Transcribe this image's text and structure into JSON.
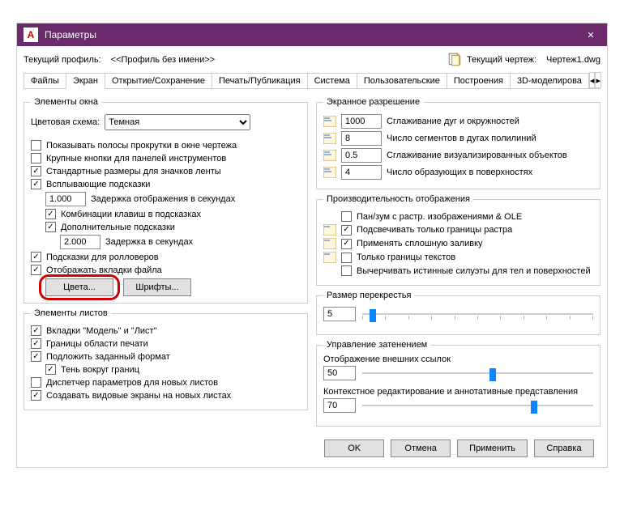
{
  "window": {
    "title": "Параметры",
    "close_icon": "✕"
  },
  "profile": {
    "current_profile_label": "Текущий профиль:",
    "current_profile_value": "<<Профиль без имени>>",
    "current_drawing_label": "Текущий чертеж:",
    "current_drawing_value": "Чертеж1.dwg"
  },
  "tabs": {
    "files": "Файлы",
    "screen": "Экран",
    "open_save": "Открытие/Сохранение",
    "print": "Печать/Публикация",
    "system": "Система",
    "user": "Пользовательские",
    "drafting": "Построения",
    "three_d": "3D-моделирова",
    "arrow_left": "◂",
    "arrow_right": "▸"
  },
  "left": {
    "window_elements": {
      "legend": "Элементы окна",
      "color_scheme_label": "Цветовая схема:",
      "color_scheme_value": "Темная",
      "scrollbars": "Показывать полосы прокрутки в окне чертежа",
      "big_buttons": "Крупные кнопки для панелей инструментов",
      "ribbon_icons": "Стандартные размеры для значков ленты",
      "tooltips": "Всплывающие подсказки",
      "delay1_value": "1.000",
      "delay1_label": "Задержка отображения в секундах",
      "shortcuts": "Комбинации клавиш в подсказках",
      "extra_tooltips": "Дополнительные подсказки",
      "delay2_value": "2.000",
      "delay2_label": "Задержка в секундах",
      "rollover": "Подсказки для ролловеров",
      "file_tabs": "Отображать вкладки файла",
      "colors_btn": "Цвета...",
      "fonts_btn": "Шрифты..."
    },
    "sheet_elements": {
      "legend": "Элементы листов",
      "model_layout": "Вкладки \"Модель\" и \"Лист\"",
      "print_bounds": "Границы области печати",
      "paper_bg": "Подложить заданный формат",
      "shadow": "Тень вокруг границ",
      "page_setup": "Диспетчер параметров для новых листов",
      "viewports": "Создавать видовые экраны на новых листах"
    }
  },
  "right": {
    "resolution": {
      "legend": "Экранное разрешение",
      "r1_value": "1000",
      "r1_label": "Сглаживание дуг и окружностей",
      "r2_value": "8",
      "r2_label": "Число сегментов в дугах полилиний",
      "r3_value": "0.5",
      "r3_label": "Сглаживание визуализированных объектов",
      "r4_value": "4",
      "r4_label": "Число образующих в поверхностях"
    },
    "performance": {
      "legend": "Производительность отображения",
      "pan_zoom": "Пан/зум с растр. изображениями & OLE",
      "raster_frame": "Подсвечивать только границы растра",
      "solid_fill": "Применять сплошную заливку",
      "text_frame": "Только границы текстов",
      "true_sil": "Вычерчивать истинные силуэты для тел и поверхностей"
    },
    "crosshair": {
      "legend": "Размер перекрестья",
      "value": "5"
    },
    "fade": {
      "legend": "Управление затенением",
      "xref_label": "Отображение внешних ссылок",
      "xref_value": "50",
      "edit_label": "Контекстное редактирование и аннотативные представления",
      "edit_value": "70"
    }
  },
  "buttons": {
    "ok": "OK",
    "cancel": "Отмена",
    "apply": "Применить",
    "help": "Справка"
  }
}
